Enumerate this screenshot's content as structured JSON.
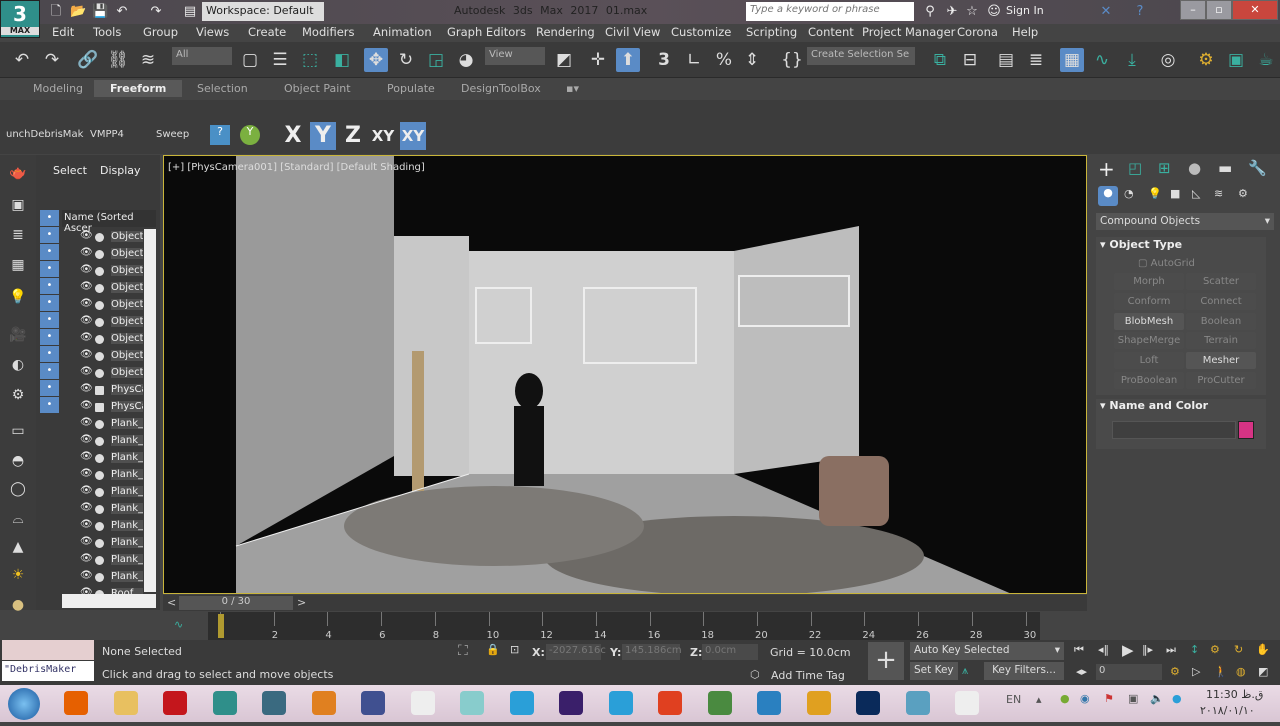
{
  "app": {
    "logo_text": "3",
    "logo_sub": "MAX",
    "title": "Autodesk 3ds Max 2017",
    "file": "01.max",
    "workspace": "Workspace: Default",
    "search_placeholder": "Type a keyword or phrase",
    "sign_in": "Sign In"
  },
  "menu": [
    "Edit",
    "Tools",
    "Group",
    "Views",
    "Create",
    "Modifiers",
    "Animation",
    "Graph Editors",
    "Rendering",
    "Civil View",
    "Customize",
    "Scripting",
    "Content",
    "Project Manager",
    "Corona",
    "Help"
  ],
  "toolbar": {
    "selection_filter": "All",
    "ref_coord": "View",
    "named_selection": "Create Selection Se",
    "snap_label": "3"
  },
  "ribbon": {
    "tabs": [
      "Modeling",
      "Freeform",
      "Selection",
      "Object Paint",
      "Populate",
      "DesignToolBox"
    ],
    "active": "Freeform",
    "items": [
      "unchDebrisMak",
      "VMPP4",
      "Sweep"
    ],
    "axes": [
      "X",
      "Y",
      "Z",
      "XY",
      "XY"
    ]
  },
  "explorer": {
    "tabs": [
      "Select",
      "Display"
    ],
    "column": "Name (Sorted Ascer",
    "rows": [
      {
        "name": "Object",
        "type": "geo"
      },
      {
        "name": "Object",
        "type": "geo"
      },
      {
        "name": "Object",
        "type": "geo"
      },
      {
        "name": "Object",
        "type": "geo"
      },
      {
        "name": "Object",
        "type": "geo"
      },
      {
        "name": "Object",
        "type": "geo"
      },
      {
        "name": "Object",
        "type": "geo"
      },
      {
        "name": "Object",
        "type": "geo"
      },
      {
        "name": "Object",
        "type": "geo"
      },
      {
        "name": "PhysCamera",
        "type": "camera"
      },
      {
        "name": "PhysCamera",
        "type": "camera"
      },
      {
        "name": "Plank_",
        "type": "geo"
      },
      {
        "name": "Plank_",
        "type": "geo"
      },
      {
        "name": "Plank_",
        "type": "geo"
      },
      {
        "name": "Plank_",
        "type": "geo"
      },
      {
        "name": "Plank_",
        "type": "geo"
      },
      {
        "name": "Plank_",
        "type": "geo"
      },
      {
        "name": "Plank_",
        "type": "geo"
      },
      {
        "name": "Plank_",
        "type": "geo"
      },
      {
        "name": "Plank_",
        "type": "geo"
      },
      {
        "name": "Plank_",
        "type": "geo"
      },
      {
        "name": "Roof",
        "type": "geo"
      }
    ]
  },
  "viewport": {
    "label": "[+] [PhysCamera001] [Standard] [Default Shading]"
  },
  "command_panel": {
    "category": "Compound Objects",
    "rollout1": "Object Type",
    "autogrid": "AutoGrid",
    "buttons": [
      {
        "label": "Morph",
        "enabled": false
      },
      {
        "label": "Scatter",
        "enabled": false
      },
      {
        "label": "Conform",
        "enabled": false
      },
      {
        "label": "Connect",
        "enabled": false
      },
      {
        "label": "BlobMesh",
        "enabled": true
      },
      {
        "label": "Boolean",
        "enabled": false
      },
      {
        "label": "ShapeMerge",
        "enabled": false
      },
      {
        "label": "Terrain",
        "enabled": false
      },
      {
        "label": "Loft",
        "enabled": false
      },
      {
        "label": "Mesher",
        "enabled": true
      },
      {
        "label": "ProBoolean",
        "enabled": false
      },
      {
        "label": "ProCutter",
        "enabled": false
      }
    ],
    "rollout2": "Name and Color",
    "color": "#d63384"
  },
  "timeline": {
    "slider": "0 / 30",
    "ticks": [
      "0",
      "2",
      "4",
      "6",
      "8",
      "10",
      "12",
      "14",
      "16",
      "18",
      "20",
      "22",
      "24",
      "26",
      "28",
      "30"
    ]
  },
  "status": {
    "script_listener": "\"DebrisMaker",
    "selection": "None Selected",
    "prompt": "Click and drag to select and move objects",
    "x_label": "X:",
    "x": "-2027.616c",
    "y_label": "Y:",
    "y": "145.186cm",
    "z_label": "Z:",
    "z": "0.0cm",
    "grid": "Grid = 10.0cm",
    "add_time_tag": "Add Time Tag",
    "auto_key": "Auto Key",
    "set_key": "Set Key",
    "key_mode": "Selected",
    "key_filters": "Key Filters...",
    "frame": "0"
  },
  "taskbar": {
    "lang": "EN",
    "time": "11:30 ق.ظ",
    "date": "۲۰۱۸/۰۱/۱۰",
    "apps": [
      "firefox",
      "explorer",
      "autocad",
      "3dsmax",
      "sketchbook",
      "media-player",
      "winrar",
      "notepad",
      "paint",
      "telegram",
      "after-effects",
      "telegram",
      "foxit",
      "earth",
      "stack",
      "chrome",
      "photoshop",
      "photo-viewer",
      "notepad"
    ]
  }
}
